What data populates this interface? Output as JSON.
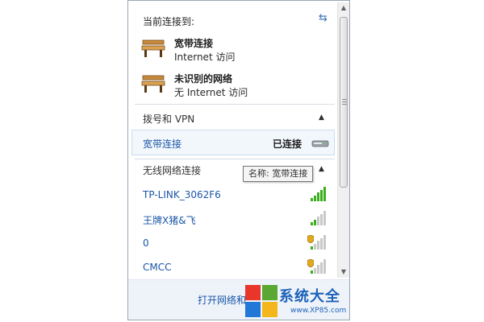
{
  "panel": {
    "header_title": "当前连接到:",
    "refresh_icon": "refresh-arrows-icon",
    "connected_networks": [
      {
        "name": "宽带连接",
        "status": "Internet 访问",
        "icon": "bench-network-icon"
      },
      {
        "name": "未识别的网络",
        "status": "无 Internet 访问",
        "icon": "bench-network-icon"
      }
    ],
    "dialup_section": {
      "label": "拨号和 VPN",
      "collapse_icon": "chevron-up-icon",
      "item": {
        "name": "宽带连接",
        "status": "已连接",
        "icon": "modem-icon"
      }
    },
    "wireless_section": {
      "label": "无线网络连接",
      "collapse_icon": "chevron-up-icon",
      "networks": [
        {
          "ssid": "TP-LINK_3062F6",
          "signal_bars": 5,
          "secured": false,
          "signal_color": "#3cae1d"
        },
        {
          "ssid": "王牌X猪&飞",
          "signal_bars": 2,
          "secured": false,
          "signal_color": "#3cae1d"
        },
        {
          "ssid": "0",
          "signal_bars": 1,
          "secured": true,
          "signal_color": "#3cae1d"
        },
        {
          "ssid": "CMCC",
          "signal_bars": 1,
          "secured": true,
          "signal_color": "#3cae1d"
        }
      ]
    },
    "tooltip": "名称: 宽带连接",
    "footer_link": "打开网络和"
  },
  "watermark": {
    "title": "系统大全",
    "url": "www.XP85.com"
  },
  "colors": {
    "link": "#1a56a8",
    "selected_row_bg": "#f2f7fc",
    "footer_bg": "#eef3fa",
    "signal_on": "#3cae1d",
    "signal_off": "#c8c8c8"
  }
}
